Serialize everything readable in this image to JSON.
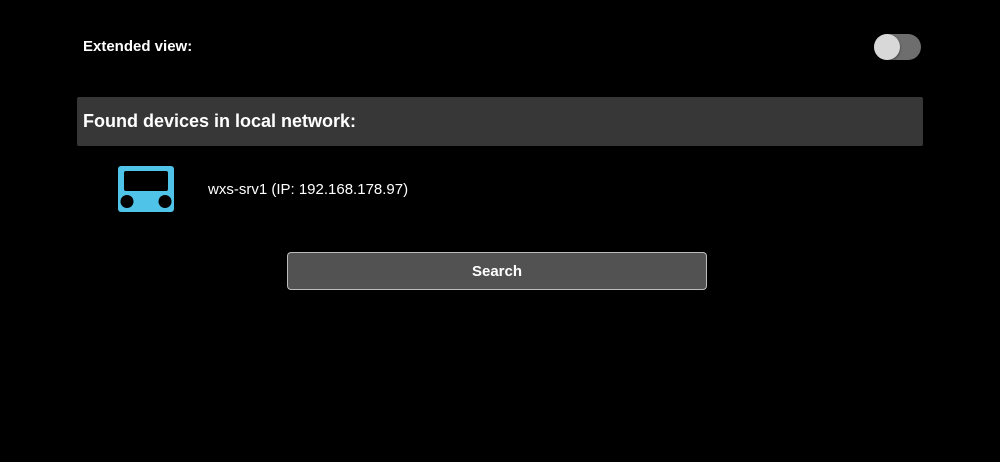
{
  "settings": {
    "extended_view_label": "Extended view:",
    "extended_view_enabled": false
  },
  "devices_section": {
    "title": "Found devices in local network:",
    "devices": [
      {
        "label": "wxs-srv1 (IP: 192.168.178.97)",
        "icon": "device-icon"
      }
    ]
  },
  "actions": {
    "search_label": "Search"
  },
  "colors": {
    "background": "#000000",
    "section_header_bg": "#373737",
    "device_icon": "#4fc3e8",
    "button_bg": "#525252",
    "toggle_track": "#6e6e6e",
    "toggle_knob": "#d8d8d8"
  }
}
